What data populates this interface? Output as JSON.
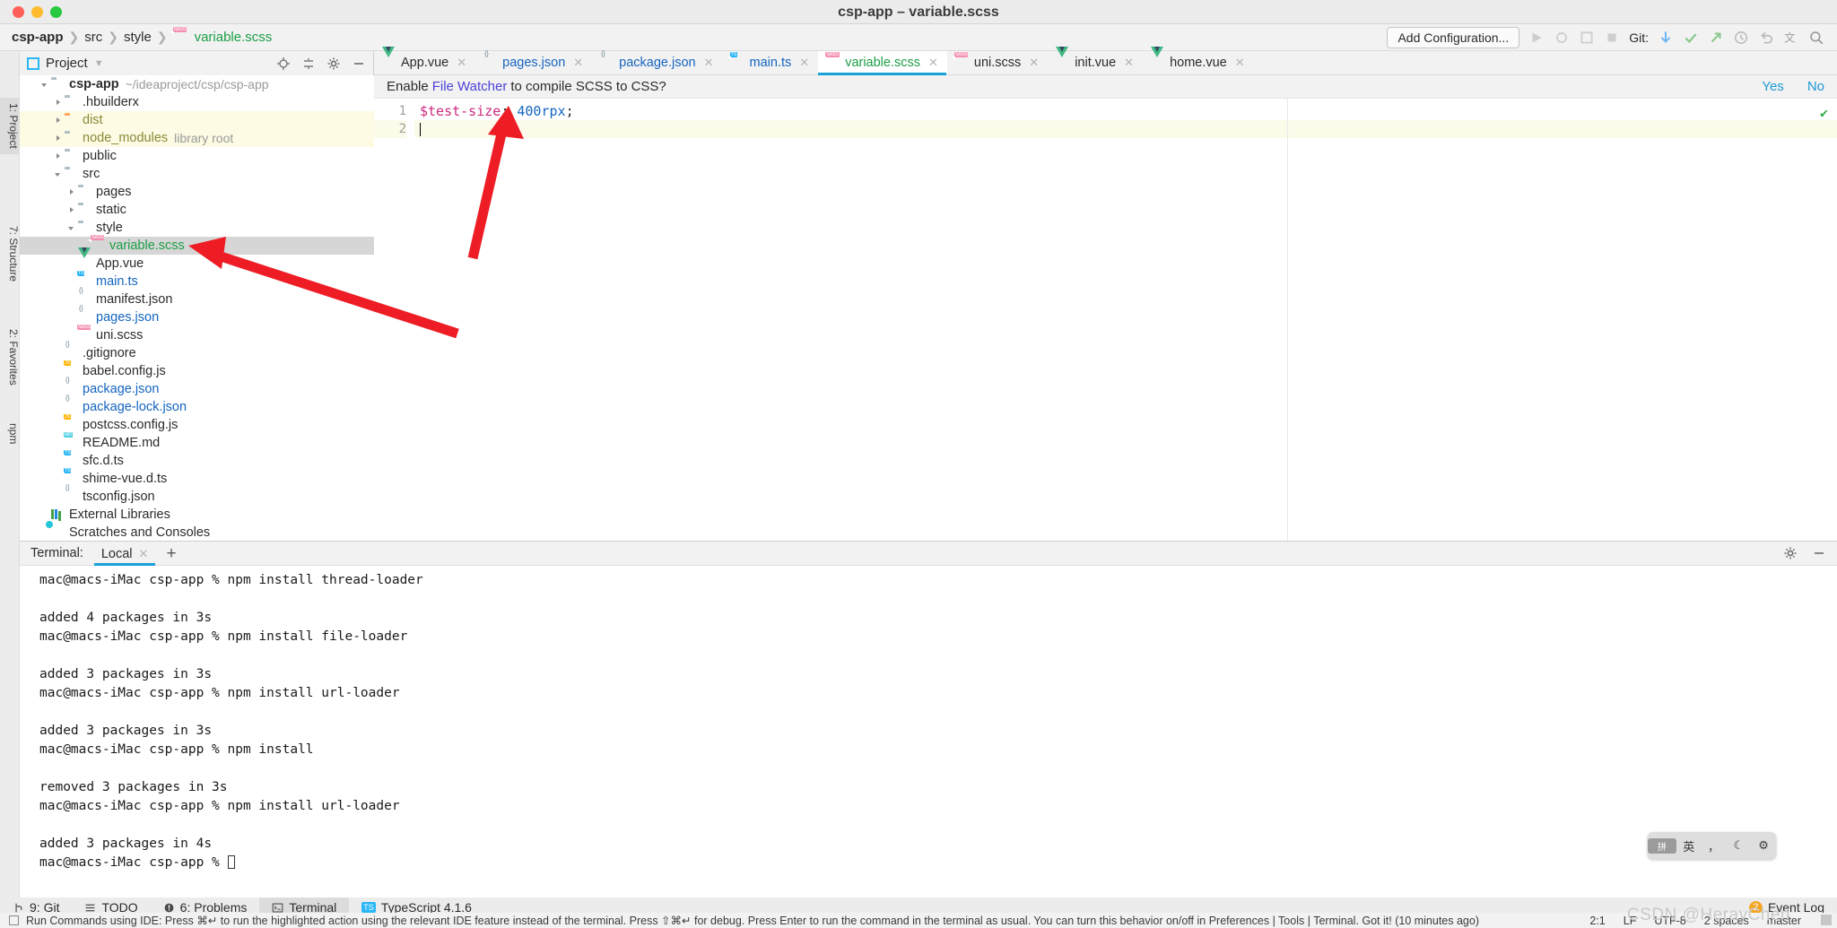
{
  "window": {
    "title": "csp-app – variable.scss"
  },
  "breadcrumb": {
    "items": [
      {
        "label": "csp-app",
        "style": "bold"
      },
      {
        "label": "src",
        "style": "plain"
      },
      {
        "label": "style",
        "style": "plain"
      },
      {
        "label": "variable.scss",
        "style": "green",
        "icon": "sass-file-icon"
      }
    ],
    "separator": "❯"
  },
  "navbar": {
    "add_configuration": "Add Configuration...",
    "git_label": "Git:",
    "icons": [
      "run-icon",
      "debug-icon",
      "coverage-icon",
      "profile-icon",
      "stop-icon",
      "git-update-icon",
      "git-commit-icon",
      "git-push-icon",
      "history-icon",
      "undo-icon",
      "translate-icon",
      "search-everywhere-icon"
    ]
  },
  "left_strip": {
    "tabs": [
      "1: Project",
      "7: Structure",
      "2: Favorites",
      "npm"
    ]
  },
  "project_panel": {
    "title": "Project",
    "tools": [
      "locate-icon",
      "collapse-all-icon",
      "gear-icon",
      "hide-icon"
    ],
    "tree": [
      {
        "depth": 0,
        "arrow": "down",
        "icon": "folder-icon",
        "label": "csp-app",
        "style": "bold",
        "sub": "~/ideaproject/csp/csp-app"
      },
      {
        "depth": 1,
        "arrow": "right",
        "icon": "folder-icon",
        "label": ".hbuilderx",
        "style": "plain",
        "sub": ""
      },
      {
        "depth": 1,
        "arrow": "right",
        "icon": "folder-orange-icon",
        "label": "dist",
        "style": "excluded",
        "sub": "",
        "row": "hl"
      },
      {
        "depth": 1,
        "arrow": "right",
        "icon": "folder-icon",
        "label": "node_modules",
        "style": "library",
        "sub": "library root",
        "row": "hl"
      },
      {
        "depth": 1,
        "arrow": "right",
        "icon": "folder-icon",
        "label": "public",
        "style": "plain",
        "sub": ""
      },
      {
        "depth": 1,
        "arrow": "down",
        "icon": "folder-icon",
        "label": "src",
        "style": "plain",
        "sub": ""
      },
      {
        "depth": 2,
        "arrow": "right",
        "icon": "folder-icon",
        "label": "pages",
        "style": "plain",
        "sub": ""
      },
      {
        "depth": 2,
        "arrow": "right",
        "icon": "folder-icon",
        "label": "static",
        "style": "plain",
        "sub": ""
      },
      {
        "depth": 2,
        "arrow": "down",
        "icon": "folder-icon",
        "label": "style",
        "style": "plain",
        "sub": ""
      },
      {
        "depth": 3,
        "arrow": "none",
        "icon": "sass-file-icon",
        "label": "variable.scss",
        "style": "green",
        "sub": "",
        "row": "selected"
      },
      {
        "depth": 2,
        "arrow": "none",
        "icon": "vue-file-icon",
        "label": "App.vue",
        "style": "plain",
        "sub": ""
      },
      {
        "depth": 2,
        "arrow": "none",
        "icon": "ts-file-icon",
        "label": "main.ts",
        "style": "blue",
        "sub": ""
      },
      {
        "depth": 2,
        "arrow": "none",
        "icon": "json-file-icon",
        "label": "manifest.json",
        "style": "plain",
        "sub": ""
      },
      {
        "depth": 2,
        "arrow": "none",
        "icon": "json-file-icon",
        "label": "pages.json",
        "style": "blue",
        "sub": ""
      },
      {
        "depth": 2,
        "arrow": "none",
        "icon": "sass-file-icon",
        "label": "uni.scss",
        "style": "plain",
        "sub": ""
      },
      {
        "depth": 1,
        "arrow": "none",
        "icon": "gitignore-file-icon",
        "label": ".gitignore",
        "style": "plain",
        "sub": ""
      },
      {
        "depth": 1,
        "arrow": "none",
        "icon": "js-file-icon",
        "label": "babel.config.js",
        "style": "plain",
        "sub": ""
      },
      {
        "depth": 1,
        "arrow": "none",
        "icon": "json-file-icon",
        "label": "package.json",
        "style": "blue",
        "sub": ""
      },
      {
        "depth": 1,
        "arrow": "none",
        "icon": "json-file-icon",
        "label": "package-lock.json",
        "style": "blue",
        "sub": ""
      },
      {
        "depth": 1,
        "arrow": "none",
        "icon": "js-file-icon",
        "label": "postcss.config.js",
        "style": "plain",
        "sub": ""
      },
      {
        "depth": 1,
        "arrow": "none",
        "icon": "md-file-icon",
        "label": "README.md",
        "style": "plain",
        "sub": ""
      },
      {
        "depth": 1,
        "arrow": "none",
        "icon": "ts-file-icon",
        "label": "sfc.d.ts",
        "style": "plain",
        "sub": ""
      },
      {
        "depth": 1,
        "arrow": "none",
        "icon": "ts-file-icon",
        "label": "shime-vue.d.ts",
        "style": "plain",
        "sub": ""
      },
      {
        "depth": 1,
        "arrow": "none",
        "icon": "json-file-icon",
        "label": "tsconfig.json",
        "style": "plain",
        "sub": ""
      },
      {
        "depth": 0,
        "arrow": "none",
        "icon": "external-libraries-icon",
        "label": "External Libraries",
        "style": "plain",
        "sub": ""
      },
      {
        "depth": 0,
        "arrow": "none",
        "icon": "scratches-icon",
        "label": "Scratches and Consoles",
        "style": "plain",
        "sub": ""
      }
    ]
  },
  "editor": {
    "tabs": [
      {
        "label": "App.vue",
        "icon": "vue-file-icon",
        "style": "plain",
        "active": false
      },
      {
        "label": "pages.json",
        "icon": "json-file-icon",
        "style": "blue",
        "active": false
      },
      {
        "label": "package.json",
        "icon": "json-file-icon",
        "style": "blue",
        "active": false
      },
      {
        "label": "main.ts",
        "icon": "ts-file-icon",
        "style": "blue",
        "active": false
      },
      {
        "label": "variable.scss",
        "icon": "sass-file-icon",
        "style": "green",
        "active": true
      },
      {
        "label": "uni.scss",
        "icon": "sass-file-icon",
        "style": "plain",
        "active": false
      },
      {
        "label": "init.vue",
        "icon": "vue-file-icon",
        "style": "red",
        "active": false
      },
      {
        "label": "home.vue",
        "icon": "vue-file-icon",
        "style": "plain",
        "active": false
      }
    ],
    "tab_close": "✕",
    "notification": {
      "text_before": "Enable",
      "link": "File Watcher",
      "text_after": "to compile SCSS to CSS?",
      "yes": "Yes",
      "no": "No"
    },
    "gutter": [
      "1",
      "2"
    ],
    "code": {
      "line1": {
        "variable": "$test-size",
        "colon": ": ",
        "value": "400rpx",
        "semi": ";"
      },
      "line2": ""
    },
    "inspection_ok": "✔"
  },
  "terminal": {
    "label": "Terminal:",
    "tab": "Local",
    "close": "✕",
    "add": "+",
    "tools": [
      "gear-icon",
      "hide-icon"
    ],
    "lines": [
      "mac@macs-iMac csp-app % npm install thread-loader",
      "",
      "added 4 packages in 3s",
      "mac@macs-iMac csp-app % npm install file-loader",
      "",
      "added 3 packages in 3s",
      "mac@macs-iMac csp-app % npm install url-loader",
      "",
      "added 3 packages in 3s",
      "mac@macs-iMac csp-app % npm install",
      "",
      "removed 3 packages in 3s",
      "mac@macs-iMac csp-app % npm install url-loader",
      "",
      "added 3 packages in 4s"
    ],
    "prompt": "mac@macs-iMac csp-app % "
  },
  "ime": {
    "keyboard": "拼",
    "mode": "英",
    "punct": "，",
    "moon": "☾",
    "gear": "⚙"
  },
  "statusbar": {
    "items": [
      {
        "label": "9: Git",
        "icon": "git-branch-icon",
        "active": false
      },
      {
        "label": "TODO",
        "icon": "todo-icon",
        "active": false
      },
      {
        "label": "6: Problems",
        "icon": "problems-icon",
        "active": false
      },
      {
        "label": "Terminal",
        "icon": "terminal-icon",
        "active": true
      },
      {
        "label": "TypeScript 4.1.6",
        "icon": "typescript-icon",
        "active": false
      }
    ],
    "event_log": {
      "label": "Event Log",
      "count": "2"
    },
    "right": [
      "2:1",
      "LF",
      "UTF-8",
      "2 spaces",
      "master"
    ],
    "branch_icon": "git-branch-icon"
  },
  "hint": {
    "text": "Run Commands using IDE: Press ⌘↵ to run the highlighted action using the relevant IDE feature instead of the terminal. Press ⇧⌘↵ for debug. Press Enter to run the command in the terminal as usual. You can turn this behavior on/off in Preferences | Tools | Terminal. Got it! (10 minutes ago)"
  },
  "watermark": "CSDN @HerayChen",
  "colors": {
    "accent": "#18a0d7",
    "green": "#1a9e45",
    "blue": "#1565c0",
    "red": "#e8432b",
    "arrow_red": "#ee1c25"
  }
}
